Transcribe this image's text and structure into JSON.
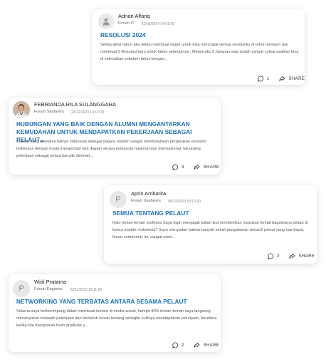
{
  "posts": [
    {
      "author": "Adnan Alfariq",
      "forum": "Forum IT",
      "date": "12/01/2024 14:01:00",
      "title": "RESOLUSI 2024",
      "excerpt": "Setiap akhir tahun aku selalu membuat target untuk bisa mencapai semua resolusiku di tahun kemarin dan membuat 5 Resolusi baru untuk tahun selanjutnya . Menurutku 5 harapan saja sudah sangat cukup asalkan bisa di selesaikan sebelum tahun bergan...",
      "comments": "1",
      "share_label": "SHARE",
      "avatar": "person-placeholder"
    },
    {
      "author": "FEBRIANDA RILA SULANGGARA",
      "forum": "Forum Seafarers",
      "date": "20/12/2023 14:12:00",
      "title": "HUBUNGAN YANG BAIK DENGAN ALUMNI MENGANTARKAN KEMUDAHAN UNTUK MENDAPATKAN PEKERJAAN SEBAGAI PELAUT...",
      "excerpt": "Seperti yang diketahui bahwa indonesia sebagai negara maritim sangat membutuhkan pergerakan ekonomi terkhusus dengan moda transportasi laut (kapal) secara pelayaran nasional dan internasional, tak jarang pekerjaan sebagai pelaut banyak diminati...",
      "comments": "3",
      "share_label": "SHARE",
      "avatar": "photo"
    },
    {
      "author": "Aprin Ambarita",
      "forum": "Forum Seafarers",
      "date": "05/12/2023 18:12:00",
      "title": "SEMUA TENTANG PELAUT",
      "excerpt": "Halo teman-teman profesea  Saya ingin mengajak kalian ikut memberikan masukan terkait bagaimana pelaut di kanca maritim indonesia? Saya menyadari bahwa banyak sekali pengalaman teman2 pelaut yang luar biasa, forum community ini, sangat mem...",
      "comments": "2",
      "share_label": "SHARE",
      "avatar_letter": "P"
    },
    {
      "author": "Widi Pratama",
      "forum": "Forum Engineer",
      "date": "03/11/2023 19:11:00",
      "title": "NETWORKING YANG TERBATAS ANTARA SESAMA PELAUT",
      "excerpt": "Selama saya berkecimpung dalam membuat konten di media sosial, hampir 80% teman-teman saya langsung menanyakan masalah pekerjaan dan berkeluh kesah tentang sebegitu sulitnya mendapatkan pekerjaan, terutama ketika kita merupakan fresh graduate y...",
      "comments": "2",
      "share_label": "SHARE",
      "avatar_letter": "P"
    }
  ],
  "colors": {
    "title": "#1a70b8",
    "text": "#555555",
    "card_bg": "#ffffff"
  },
  "icons": {
    "comment": "comment-bubble-icon",
    "share": "share-arrow-icon"
  }
}
